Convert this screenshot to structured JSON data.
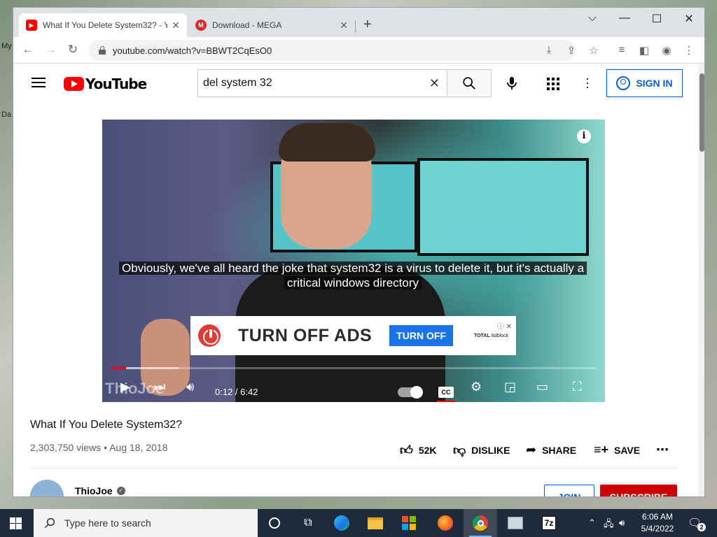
{
  "desktop": {
    "icon_labels": [
      "My",
      "Da"
    ]
  },
  "browser": {
    "tabs": [
      {
        "title": "What If You Delete System32? - Y",
        "close": "✕"
      },
      {
        "title": "Download - MEGA",
        "close": "✕"
      }
    ],
    "new_tab": "+",
    "url": "youtube.com/watch?v=BBWT2CqEsO0"
  },
  "youtube": {
    "logo_text": "YouTube",
    "search_value": "del system 32",
    "sign_in": "SIGN IN",
    "player": {
      "caption": "Obviously, we've all heard the joke that system32 is a virus to delete it, but it's actually a critical windows directory",
      "ad_headline": "TURN OFF ADS",
      "ad_cta": "TURN OFF",
      "ad_brand_bold": "TOTAL",
      "ad_brand": "Adblock",
      "time": "0:12 / 6:42",
      "cc_label": "CC",
      "watermark": "ThioJoe",
      "played_fraction": 0.031,
      "loaded_fraction": 0.14
    },
    "video": {
      "title": "What If You Delete System32?",
      "meta": "2,303,750 views • Aug 18, 2018",
      "likes": "52K",
      "dislike": "DISLIKE",
      "share": "SHARE",
      "save": "SAVE"
    },
    "channel": {
      "name": "ThioJoe",
      "join": "JOIN",
      "subscribe": "SUBSCRIBE"
    }
  },
  "taskbar": {
    "search_placeholder": "Type here to search",
    "time": "6:06 AM",
    "date": "5/4/2022",
    "notification_count": "2",
    "app_7z": "7z"
  },
  "colors": {
    "youtube_red": "#ff0000",
    "link_blue": "#065fd4",
    "taskbar": "#1f2b3a"
  }
}
